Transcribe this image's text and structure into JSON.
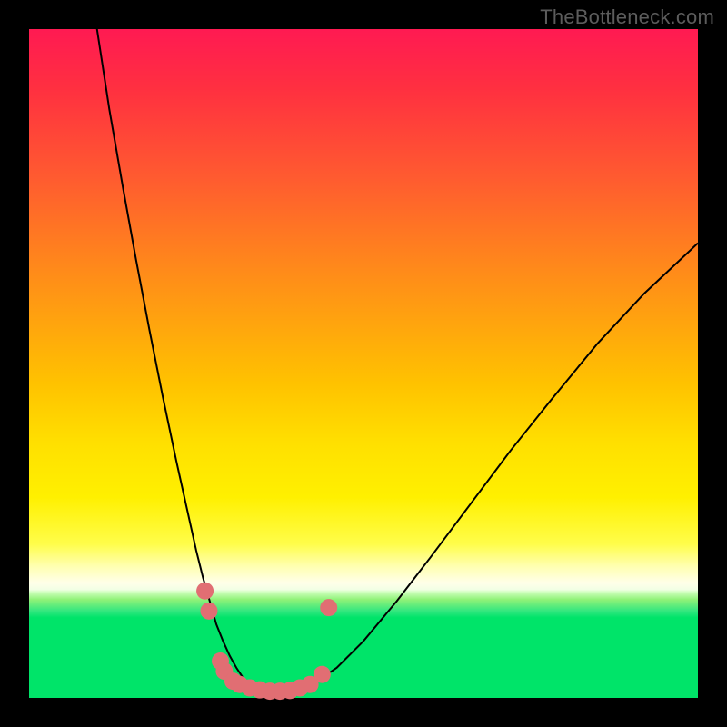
{
  "watermark": "TheBottleneck.com",
  "colors": {
    "page_bg": "#000000",
    "gradient_top": "#ff1a52",
    "gradient_mid1": "#ff8a1a",
    "gradient_mid2": "#ffe000",
    "gradient_mid3": "#ffffb0",
    "gradient_bottom": "#00e469",
    "curve": "#000000",
    "marker_fill": "#e16e73",
    "marker_stroke": "#d65a60"
  },
  "chart_data": {
    "type": "line",
    "title": "",
    "xlabel": "",
    "ylabel": "",
    "xlim": [
      0,
      100
    ],
    "ylim": [
      0,
      100
    ],
    "grid": false,
    "series": [
      {
        "name": "bottleneck-curve",
        "x": [
          10,
          12,
          14,
          16,
          18,
          20,
          22,
          24,
          25,
          26,
          27,
          28,
          29,
          30,
          31,
          32,
          33,
          35,
          38,
          42,
          46,
          50,
          55,
          60,
          66,
          72,
          78,
          85,
          92,
          100
        ],
        "y": [
          101,
          88,
          76.5,
          65.5,
          55,
          45,
          35.5,
          26.5,
          22,
          18,
          14.5,
          11,
          8.5,
          6.3,
          4.5,
          3.0,
          2.1,
          1.1,
          1.0,
          1.8,
          4.5,
          8.5,
          14.5,
          21,
          29,
          37,
          44.5,
          53,
          60.5,
          68
        ]
      }
    ],
    "markers": [
      {
        "x": 26.3,
        "y": 16.0
      },
      {
        "x": 26.9,
        "y": 13.0
      },
      {
        "x": 28.6,
        "y": 5.5
      },
      {
        "x": 29.2,
        "y": 4.0
      },
      {
        "x": 30.5,
        "y": 2.5
      },
      {
        "x": 31.5,
        "y": 2.0
      },
      {
        "x": 33.0,
        "y": 1.5
      },
      {
        "x": 34.5,
        "y": 1.2
      },
      {
        "x": 36.0,
        "y": 1.0
      },
      {
        "x": 37.5,
        "y": 1.0
      },
      {
        "x": 39.0,
        "y": 1.1
      },
      {
        "x": 40.5,
        "y": 1.5
      },
      {
        "x": 42.0,
        "y": 2.0
      },
      {
        "x": 43.8,
        "y": 3.5
      },
      {
        "x": 44.8,
        "y": 13.5
      }
    ]
  }
}
